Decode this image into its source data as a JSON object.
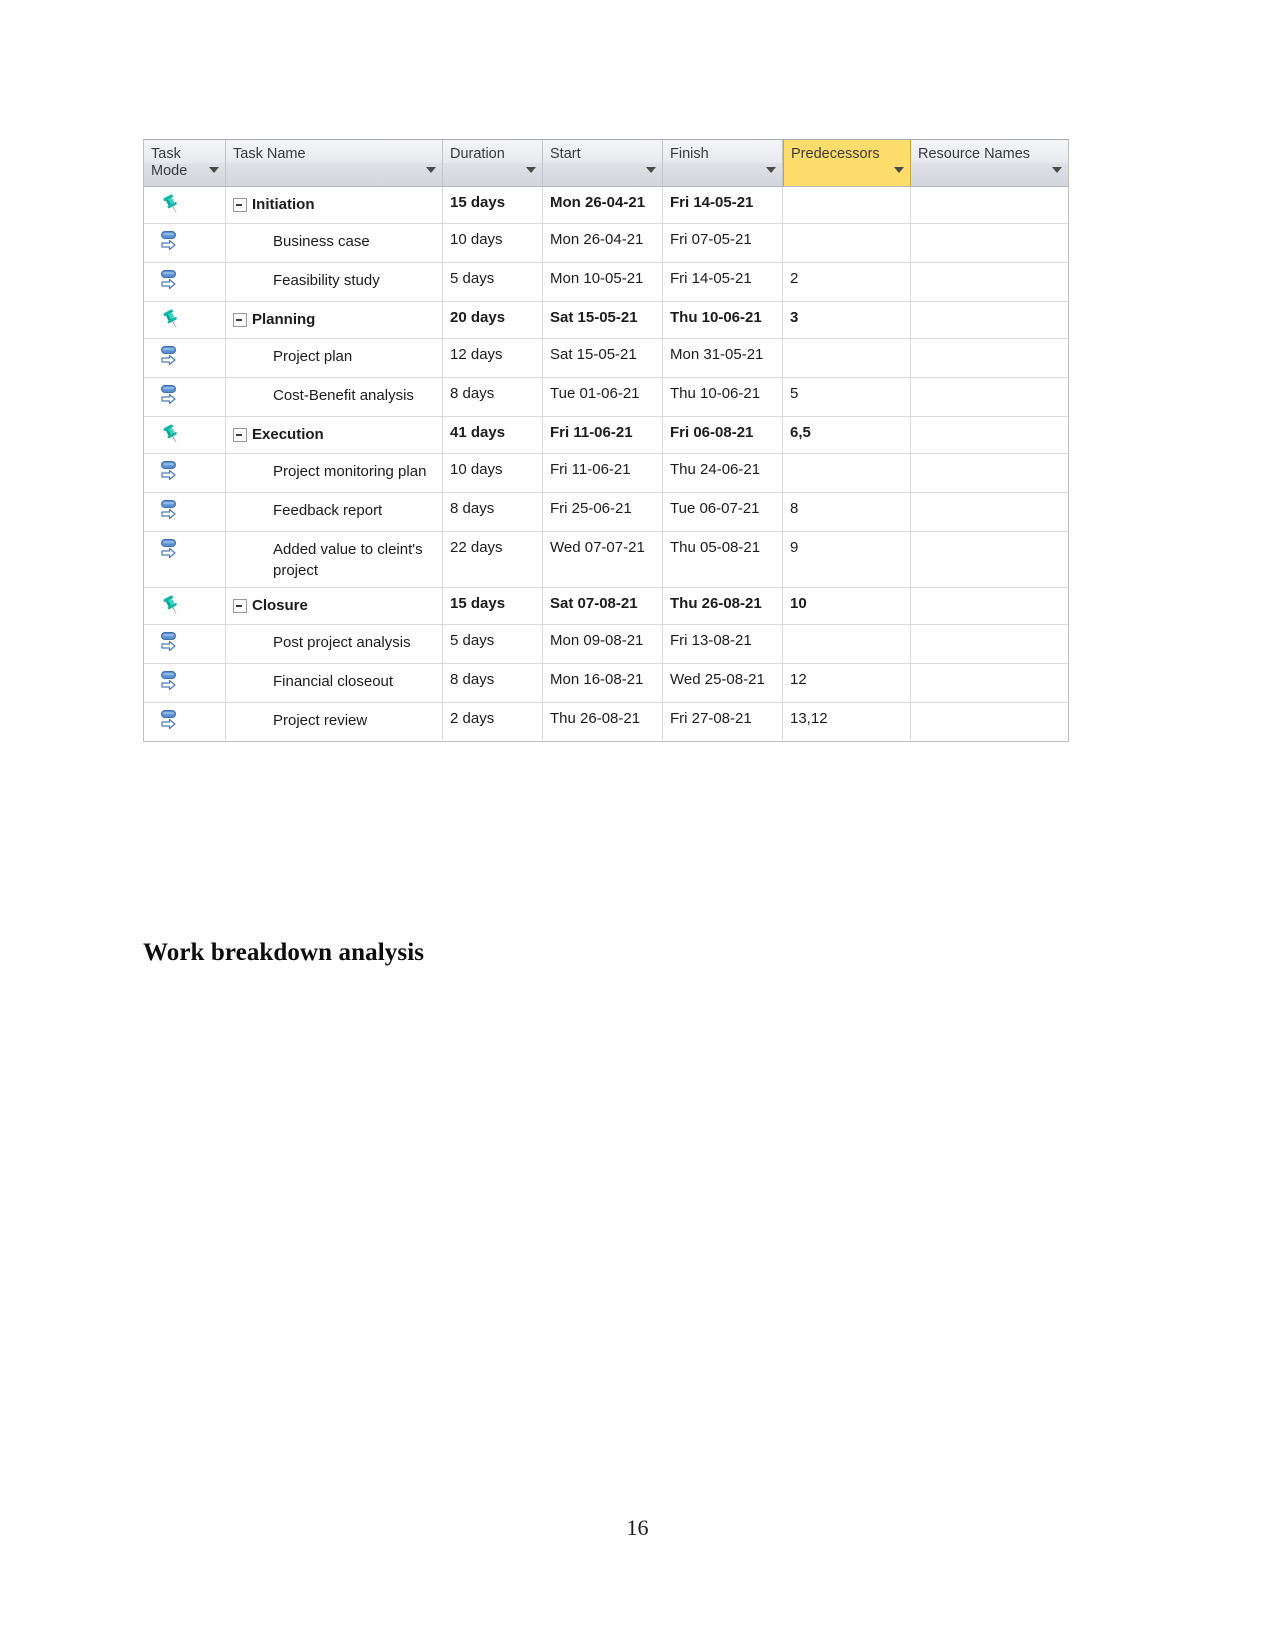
{
  "document": {
    "heading": "Work breakdown analysis",
    "page_number": "16"
  },
  "task_table": {
    "columns": [
      {
        "key": "task_mode",
        "label": "Task\nMode",
        "sortable": true,
        "highlighted": false
      },
      {
        "key": "task_name",
        "label": "Task Name",
        "sortable": true,
        "highlighted": false
      },
      {
        "key": "duration",
        "label": "Duration",
        "sortable": true,
        "highlighted": false
      },
      {
        "key": "start",
        "label": "Start",
        "sortable": true,
        "highlighted": false
      },
      {
        "key": "finish",
        "label": "Finish",
        "sortable": true,
        "highlighted": false
      },
      {
        "key": "predecessors",
        "label": "Predecessors",
        "sortable": true,
        "highlighted": true
      },
      {
        "key": "resource_names",
        "label": "Resource Names",
        "sortable": true,
        "highlighted": false
      }
    ],
    "highlight_color": "#ffdd6d",
    "rows": [
      {
        "mode_icon": "manual-pin-icon",
        "summary": true,
        "name": "Initiation",
        "duration": "15 days",
        "start": "Mon 26-04-21",
        "finish": "Fri 14-05-21",
        "predecessors": "",
        "resources": ""
      },
      {
        "mode_icon": "auto-schedule-icon",
        "summary": false,
        "name": "Business case",
        "duration": "10 days",
        "start": "Mon 26-04-21",
        "finish": "Fri 07-05-21",
        "predecessors": "",
        "resources": ""
      },
      {
        "mode_icon": "auto-schedule-icon",
        "summary": false,
        "name": "Feasibility study",
        "duration": "5 days",
        "start": "Mon 10-05-21",
        "finish": "Fri 14-05-21",
        "predecessors": "2",
        "resources": ""
      },
      {
        "mode_icon": "manual-pin-icon",
        "summary": true,
        "name": "Planning",
        "duration": "20 days",
        "start": "Sat 15-05-21",
        "finish": "Thu 10-06-21",
        "predecessors": "3",
        "resources": ""
      },
      {
        "mode_icon": "auto-schedule-icon",
        "summary": false,
        "name": "Project plan",
        "duration": "12 days",
        "start": "Sat 15-05-21",
        "finish": "Mon 31-05-21",
        "predecessors": "",
        "resources": ""
      },
      {
        "mode_icon": "auto-schedule-icon",
        "summary": false,
        "name": "Cost-Benefit analysis",
        "duration": "8 days",
        "start": "Tue 01-06-21",
        "finish": "Thu 10-06-21",
        "predecessors": "5",
        "resources": ""
      },
      {
        "mode_icon": "manual-pin-icon",
        "summary": true,
        "name": "Execution",
        "duration": "41 days",
        "start": "Fri 11-06-21",
        "finish": "Fri 06-08-21",
        "predecessors": "6,5",
        "resources": ""
      },
      {
        "mode_icon": "auto-schedule-icon",
        "summary": false,
        "name": "Project monitoring plan",
        "duration": "10 days",
        "start": "Fri 11-06-21",
        "finish": "Thu 24-06-21",
        "predecessors": "",
        "resources": ""
      },
      {
        "mode_icon": "auto-schedule-icon",
        "summary": false,
        "name": "Feedback report",
        "duration": "8 days",
        "start": "Fri 25-06-21",
        "finish": "Tue 06-07-21",
        "predecessors": "8",
        "resources": ""
      },
      {
        "mode_icon": "auto-schedule-icon",
        "summary": false,
        "name": "Added value to cleint's project",
        "duration": "22 days",
        "start": "Wed 07-07-21",
        "finish": "Thu 05-08-21",
        "predecessors": "9",
        "resources": ""
      },
      {
        "mode_icon": "manual-pin-icon",
        "summary": true,
        "name": "Closure",
        "duration": "15 days",
        "start": "Sat 07-08-21",
        "finish": "Thu 26-08-21",
        "predecessors": "10",
        "resources": ""
      },
      {
        "mode_icon": "auto-schedule-icon",
        "summary": false,
        "name": "Post project analysis",
        "duration": "5 days",
        "start": "Mon 09-08-21",
        "finish": "Fri 13-08-21",
        "predecessors": "",
        "resources": ""
      },
      {
        "mode_icon": "auto-schedule-icon",
        "summary": false,
        "name": "Financial closeout",
        "duration": "8 days",
        "start": "Mon 16-08-21",
        "finish": "Wed 25-08-21",
        "predecessors": "12",
        "resources": ""
      },
      {
        "mode_icon": "auto-schedule-icon",
        "summary": false,
        "name": "Project review",
        "duration": "2 days",
        "start": "Thu 26-08-21",
        "finish": "Fri 27-08-21",
        "predecessors": "13,12",
        "resources": ""
      }
    ]
  }
}
